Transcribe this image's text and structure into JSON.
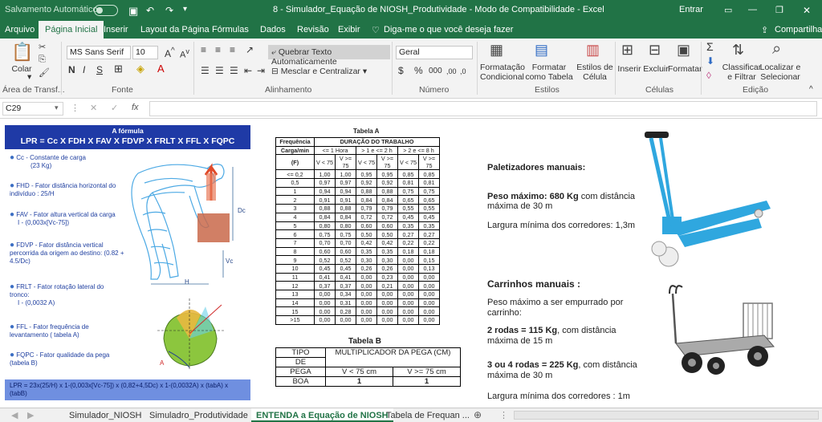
{
  "titlebar": {
    "autosave": "Salvamento Automático",
    "doc_title": "8 - Simulador_Equação de NIOSH_Produtividade  -  Modo de Compatibilidade  -  Excel",
    "signin": "Entrar"
  },
  "tabs": [
    "Arquivo",
    "Página Inicial",
    "Inserir",
    "Layout da Página",
    "Fórmulas",
    "Dados",
    "Revisão",
    "Exibir"
  ],
  "tell_me": "Diga-me o que você deseja fazer",
  "share": "Compartilhar",
  "ribbon": {
    "paste": "Colar",
    "clipboard": "Área de Transf...",
    "font_name": "MS Sans Serif",
    "font_size": "10",
    "font_group": "Fonte",
    "wrap": "Quebrar Texto Automaticamente",
    "merge": "Mesclar e Centralizar",
    "align_group": "Alinhamento",
    "number_format": "Geral",
    "number_group": "Número",
    "cond_format": "Formatação Condicional",
    "format_table": "Formatar como Tabela",
    "cell_styles": "Estilos de Célula",
    "styles_group": "Estilos",
    "insert": "Inserir",
    "delete": "Excluir",
    "format": "Formatar",
    "cells_group": "Células",
    "sort": "Classificar e Filtrar",
    "find": "Localizar e Selecionar",
    "edit_group": "Edição"
  },
  "formula_bar": {
    "cell_ref": "C29",
    "fx": "fx",
    "value": ""
  },
  "sheet": {
    "formula_title": "A fórmula",
    "formula": "LPR = Cc X FDH X FAV X FDVP X FRLT X FFL X FQPC",
    "factors": [
      {
        "l1": "Cc - Constante de carga",
        "l2": "(23 Kg)"
      },
      {
        "l1": "FHD - Fator distância horizontal do",
        "l2": "indivíduo : 25/H"
      },
      {
        "l1": "FAV - Fator altura vertical da carga",
        "l2": "I - (0,003x[Vc-75])"
      },
      {
        "l1": "FDVP - Fator distância vertical",
        "l2": "percorrida da origem ao destino: (0.82 +",
        "l3": "4.5/Dc)"
      },
      {
        "l1": "FRLT - Fator rotação lateral do",
        "l2": "tronco:",
        "l3": "I - (0,0032 A)"
      },
      {
        "l1": "FFL - Fator frequência de",
        "l2": "levantamento ( tabela A)"
      },
      {
        "l1": "FQPC - Fator qualidade da pega",
        "l2": "(tabela B)"
      }
    ],
    "fig_labels": {
      "dc": "Dc",
      "vc": "Vc",
      "h": "H",
      "a": "A"
    },
    "bottom_formula": "LPR = 23x(25/H) x 1-(0,003x[Vc-75]) x (0,82+4,5Dc) x 1-(0,0032A) x (tabA) x (tabB)",
    "tableA": {
      "title": "Tabela A",
      "h_freq": "Frequência",
      "h_dur": "DURAÇÃO DO TRABALHO",
      "h_carga": "Carga/min",
      "h_g1": "<= 1 Hora",
      "h_g2": "> 1 e <= 2 h",
      "h_g3": "> 2 e <= 8 h",
      "h_f": "(F)",
      "h_lt": "V < 75",
      "h_ge": "V >= 75",
      "rows": [
        [
          "<= 0,2",
          "1,00",
          "1,00",
          "0,95",
          "0,95",
          "0,85",
          "0,85"
        ],
        [
          "0,5",
          "0,97",
          "0,97",
          "0,92",
          "0,92",
          "0,81",
          "0,81"
        ],
        [
          "1",
          "0,94",
          "0,94",
          "0,88",
          "0,88",
          "0,75",
          "0,75"
        ],
        [
          "2",
          "0,91",
          "0,91",
          "0,84",
          "0,84",
          "0,65",
          "0,65"
        ],
        [
          "3",
          "0,88",
          "0,88",
          "0,79",
          "0,79",
          "0,55",
          "0,55"
        ],
        [
          "4",
          "0,84",
          "0,84",
          "0,72",
          "0,72",
          "0,45",
          "0,45"
        ],
        [
          "5",
          "0,80",
          "0,80",
          "0,60",
          "0,60",
          "0,35",
          "0,35"
        ],
        [
          "6",
          "0,75",
          "0,75",
          "0,50",
          "0,50",
          "0,27",
          "0,27"
        ],
        [
          "7",
          "0,70",
          "0,70",
          "0,42",
          "0,42",
          "0,22",
          "0,22"
        ],
        [
          "8",
          "0,60",
          "0,60",
          "0,35",
          "0,35",
          "0,18",
          "0,18"
        ],
        [
          "9",
          "0,52",
          "0,52",
          "0,30",
          "0,30",
          "0,00",
          "0,15"
        ],
        [
          "10",
          "0,45",
          "0,45",
          "0,26",
          "0,26",
          "0,00",
          "0,13"
        ],
        [
          "11",
          "0,41",
          "0,41",
          "0,00",
          "0,23",
          "0,00",
          "0,00"
        ],
        [
          "12",
          "0,37",
          "0,37",
          "0,00",
          "0,21",
          "0,00",
          "0,00"
        ],
        [
          "13",
          "0,00",
          "0,34",
          "0,00",
          "0,00",
          "0,00",
          "0,00"
        ],
        [
          "14",
          "0,00",
          "0,31",
          "0,00",
          "0,00",
          "0,00",
          "0,00"
        ],
        [
          "15",
          "0,00",
          "0,28",
          "0,00",
          "0,00",
          "0,00",
          "0,00"
        ],
        [
          ">15",
          "0,00",
          "0,00",
          "0,00",
          "0,00",
          "0,00",
          "0,00"
        ]
      ]
    },
    "tableB": {
      "title": "Tabela B",
      "h_tipo": "TIPO",
      "h_de": "DE",
      "h_pega": "PEGA",
      "h_mult": "MULTIPLICADOR DA PEGA (CM)",
      "h_lt": "V < 75 cm",
      "h_ge": "V >= 75 cm",
      "row_label": "BOA",
      "row_v1": "1",
      "row_v2": "1"
    },
    "right": {
      "pal_title": "Paletizadores manuais:",
      "pal_peso_b": "Peso máximo: 680 Kg",
      "pal_peso_r": " com distância",
      "pal_peso_2": "máxima de 30 m",
      "pal_larg": "Largura mínima dos corredores: 1,3m",
      "car_title": "Carrinhos manuais :",
      "car_peso1": "Peso máximo a ser empurrado por",
      "car_peso2": "carrinho:",
      "car_2r_b": "2 rodas = 115 Kg",
      "car_2r_r": ", com distância",
      "car_2r_2": "máxima de 15 m",
      "car_3r_b": "3 ou 4 rodas = 225 Kg",
      "car_3r_r": ", com distância",
      "car_3r_2": "máxima de 30 m",
      "car_larg": "Largura mínima dos corredores : 1m"
    }
  },
  "sheet_tabs": [
    "Simulador_NIOSH",
    "Simuladro_Produtividade",
    "ENTENDA a Equação de NIOSH",
    "Tabela de Frequan ..."
  ],
  "colors": {
    "excel_green": "#217346",
    "formula_blue": "#1f3aa6",
    "bottom_box": "#6f8fe0",
    "pallet_blue": "#2fa7df"
  }
}
